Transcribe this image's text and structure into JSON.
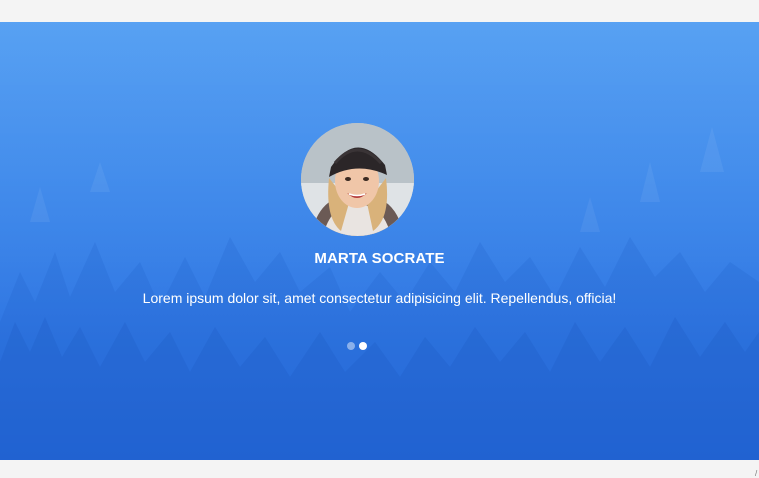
{
  "testimonial": {
    "name": "MARTA SOCRATE",
    "quote": "Lorem ipsum dolor sit, amet consectetur adipisicing elit. Repellendus, officia!"
  },
  "carousel": {
    "slide_count": 2,
    "active_index": 1
  },
  "colors": {
    "hero_top": "#4d9bf2",
    "hero_bottom": "#2468dc",
    "page_background": "#f3f3f3",
    "text": "#ffffff"
  }
}
